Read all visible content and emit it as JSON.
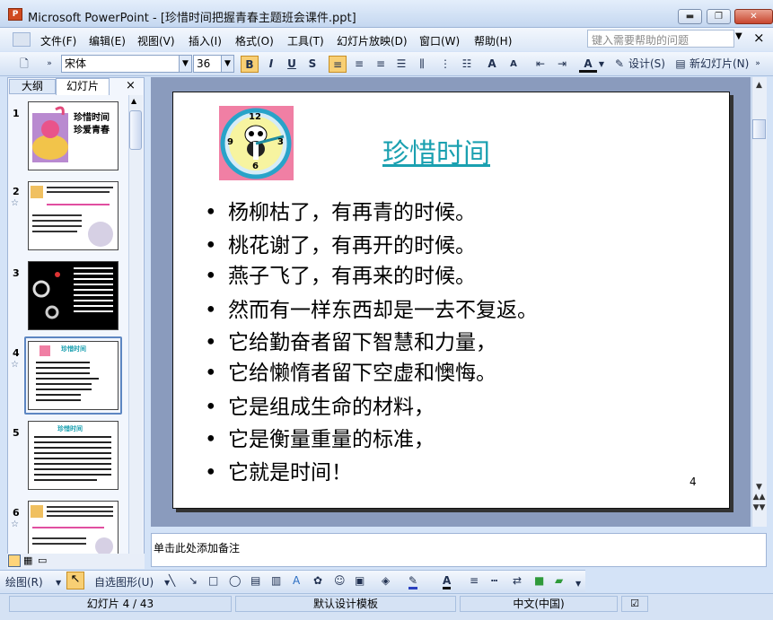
{
  "window": {
    "title": "Microsoft PowerPoint - [珍惜时间把握青春主题班会课件.ppt]",
    "app_icon": "P"
  },
  "window_controls": {
    "minimize": "▬",
    "restore": "❐",
    "close": "✕"
  },
  "menu": [
    "文件(F)",
    "编辑(E)",
    "视图(V)",
    "插入(I)",
    "格式(O)",
    "工具(T)",
    "幻灯片放映(D)",
    "窗口(W)",
    "帮助(H)"
  ],
  "help_box": {
    "placeholder": "键入需要帮助的问题",
    "close": "×"
  },
  "toolbar": {
    "font": "宋体",
    "font_size": "36",
    "bold": "B",
    "italic": "I",
    "underline": "U",
    "shadow": "S",
    "font_up": "A",
    "font_down": "A",
    "design": "设计(S)",
    "new_slide": "新幻灯片(N)"
  },
  "panel": {
    "tab_outline": "大纲",
    "tab_slides": "幻灯片",
    "close": "×"
  },
  "thumbnails": [
    {
      "num": "1",
      "star": ""
    },
    {
      "num": "2",
      "star": "☆"
    },
    {
      "num": "3",
      "star": ""
    },
    {
      "num": "4",
      "star": "☆"
    },
    {
      "num": "5",
      "star": ""
    },
    {
      "num": "6",
      "star": "☆"
    }
  ],
  "thumb_text": {
    "s1_line1": "珍惜时间",
    "s1_line2": "珍爱青春",
    "s4_title": "珍惜时间",
    "s5_title": "珍惜时间"
  },
  "slide": {
    "title": "珍惜时间",
    "bullets": [
      "杨柳枯了，有再青的时候。",
      "桃花谢了，有再开的时候。",
      "燕子飞了，有再来的时候。",
      "然而有一样东西却是一去不复返。",
      "它给勤奋者留下智慧和力量，",
      "它给懒惰者留下空虚和懊悔。",
      "它是组成生命的材料，",
      "它是衡量重量的标准，",
      "它就是时间！"
    ],
    "bullet_char": "•",
    "number": "4"
  },
  "clock_numbers": {
    "n12": "12",
    "n3": "3",
    "n6": "6",
    "n9": "9"
  },
  "notes": {
    "placeholder": "单击此处添加备注"
  },
  "drawing": {
    "draw": "绘图(R)",
    "autoshapes": "自选图形(U)"
  },
  "status": {
    "slide": "幻灯片 4 / 43",
    "template": "默认设计模板",
    "language": "中文(中国)"
  },
  "colors": {
    "accent": "#1aa0b0",
    "title_bar": "#c4d7f0",
    "selected": "#5d86c2"
  }
}
